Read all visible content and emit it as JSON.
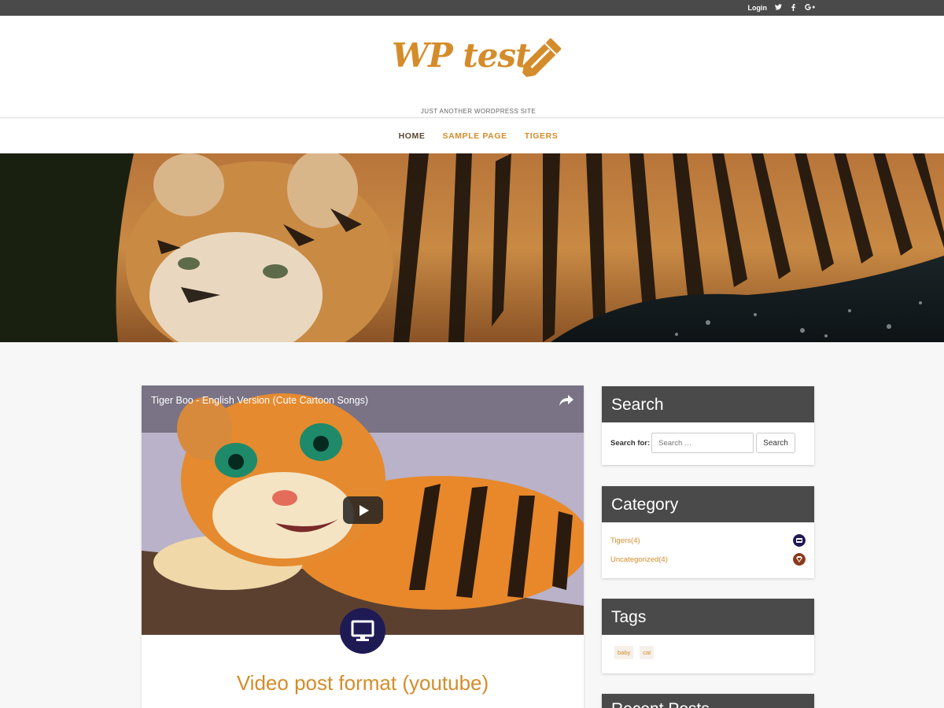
{
  "topbar": {
    "login_label": "Login",
    "social": [
      "twitter-icon",
      "facebook-icon",
      "google-plus-icon"
    ]
  },
  "site": {
    "title": "WP test",
    "tagline": "JUST ANOTHER WORDPRESS SITE",
    "accent_color": "#d48c2a"
  },
  "nav": {
    "items": [
      {
        "label": "HOME",
        "active": true
      },
      {
        "label": "SAMPLE PAGE",
        "active": false
      },
      {
        "label": "TIGERS",
        "active": false
      }
    ]
  },
  "hero": {
    "image": "tiger-banner"
  },
  "post": {
    "video_title": "Tiger Boo - English Version (Cute Cartoon Songs)",
    "format_icon": "desktop-icon",
    "title": "Video post format (youtube)"
  },
  "sidebar": {
    "search": {
      "heading": "Search",
      "label": "Search for:",
      "placeholder": "Search …",
      "button_label": "Search"
    },
    "category": {
      "heading": "Category",
      "items": [
        {
          "label": "Tigers(4)",
          "icon": "printer-icon"
        },
        {
          "label": "Uncategorized(4)",
          "icon": "gem-icon"
        }
      ]
    },
    "tags": {
      "heading": "Tags",
      "items": [
        "baby",
        "cat"
      ]
    },
    "recent": {
      "heading": "Recent Posts"
    }
  }
}
